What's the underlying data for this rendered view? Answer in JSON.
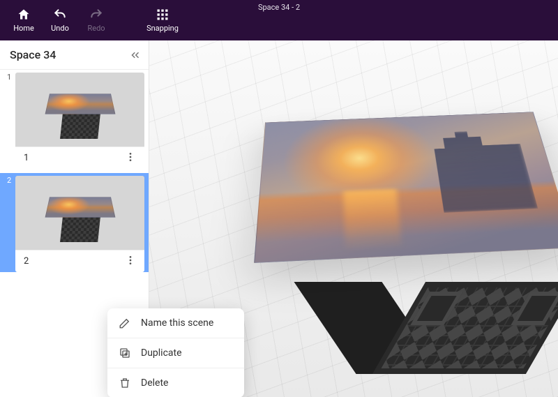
{
  "topbar": {
    "title": "Space 34 - 2",
    "home": "Home",
    "undo": "Undo",
    "redo": "Redo",
    "snapping": "Snapping"
  },
  "sidebar": {
    "title": "Space 34"
  },
  "scenes": [
    {
      "index": "1",
      "label": "1",
      "selected": false
    },
    {
      "index": "2",
      "label": "2",
      "selected": true
    }
  ],
  "context_menu": {
    "rename": "Name this scene",
    "duplicate": "Duplicate",
    "delete": "Delete"
  }
}
